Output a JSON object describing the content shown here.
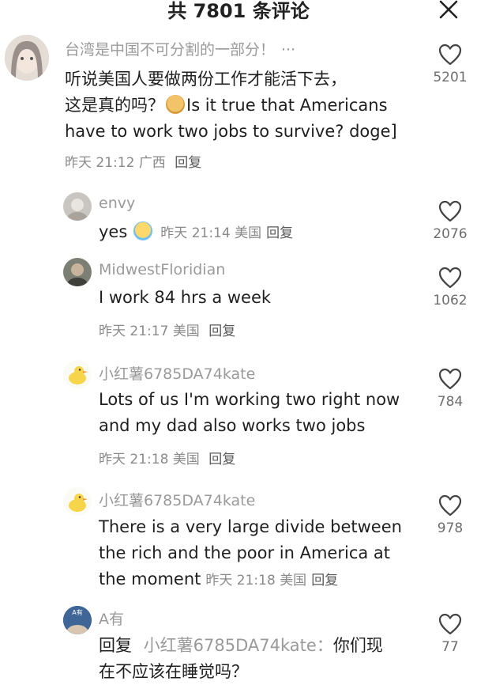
{
  "header": {
    "title": "共 7801 条评论"
  },
  "comments": [
    {
      "username": "台湾是中国不可分割的一部分！",
      "more": "···",
      "line1": "听说美国人要做两份工作才能活下去，",
      "line2a": "这是真的吗？",
      "line2b": "Is it true that Americans",
      "line3": "have to work two jobs to survive? doge]",
      "time": "昨天 21:12",
      "location": "广西",
      "reply": "回复",
      "likes": "5201"
    },
    {
      "username": "envy",
      "text": "yes",
      "time": "昨天 21:14",
      "location": "美国",
      "reply": "回复",
      "likes": "2076"
    },
    {
      "username": "MidwestFloridian",
      "text": "I work 84 hrs a week",
      "time": "昨天 21:17",
      "location": "美国",
      "reply": "回复",
      "likes": "1062"
    },
    {
      "username": "小红薯6785DA74kate",
      "line1": "Lots of us I'm working two right now",
      "line2": "and my dad also works two jobs",
      "time": "昨天 21:18",
      "location": "美国",
      "reply": "回复",
      "likes": "784"
    },
    {
      "username": "小红薯6785DA74kate",
      "line1": "There is a very large divide between",
      "line2": "the rich and the poor in America at",
      "line3": "the moment",
      "time": "昨天 21:18",
      "location": "美国",
      "reply": "回复",
      "likes": "978"
    },
    {
      "username": "A有",
      "avatar_text": "A有",
      "reply_prefix": "回复",
      "reply_target": "小红薯6785DA74kate：",
      "text1": "你们现",
      "text2": "在不应该在睡觉吗？",
      "likes": "77"
    }
  ],
  "icons": {
    "close": "close-icon",
    "like": "heart-outline-icon"
  },
  "colors": {
    "text": "#1f1f1f",
    "muted": "#9a9a9a",
    "meta": "#8a8a8a"
  }
}
